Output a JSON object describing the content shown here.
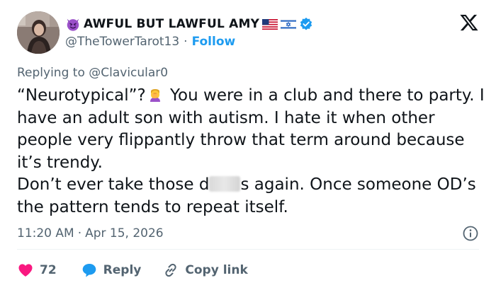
{
  "author": {
    "display_name": "AWFUL BUT LAWFUL AMY",
    "handle": "@TheTowerTarot13",
    "separator": "·",
    "follow_label": "Follow"
  },
  "reply_context": {
    "prefix": "Replying to",
    "mention": "@Clavicular0"
  },
  "body": {
    "p1_before_emoji": "“Neurotypical”?",
    "p1_after_emoji": " You were in a club and there to party. I have an adult son with autism. I hate it when other people very flippantly throw that term around because it’s trendy.",
    "p2_before_blur": "Don’t ever take those d",
    "p2_after_blur": "s again. Once someone OD’s the pattern tends to repeat itself."
  },
  "timestamp": {
    "time": "11:20 AM",
    "separator": "·",
    "date": "Apr 15, 2026"
  },
  "actions": {
    "like_count": "72",
    "reply_label": "Reply",
    "copy_link_label": "Copy link"
  },
  "colors": {
    "accent_blue": "#1d9bf0",
    "like_red": "#f91880",
    "muted_text": "#536471",
    "primary_text": "#0f1419"
  },
  "icons": {
    "name_prefix": "smiling-devil-icon",
    "flags": [
      "us-flag-icon",
      "israel-flag-icon"
    ],
    "badge": "verified-badge-icon",
    "brand": "x-logo-icon",
    "emoji": "facepalm-emoji-icon",
    "info": "info-icon",
    "like": "heart-icon",
    "reply": "reply-bubble-icon",
    "copy": "link-icon"
  }
}
